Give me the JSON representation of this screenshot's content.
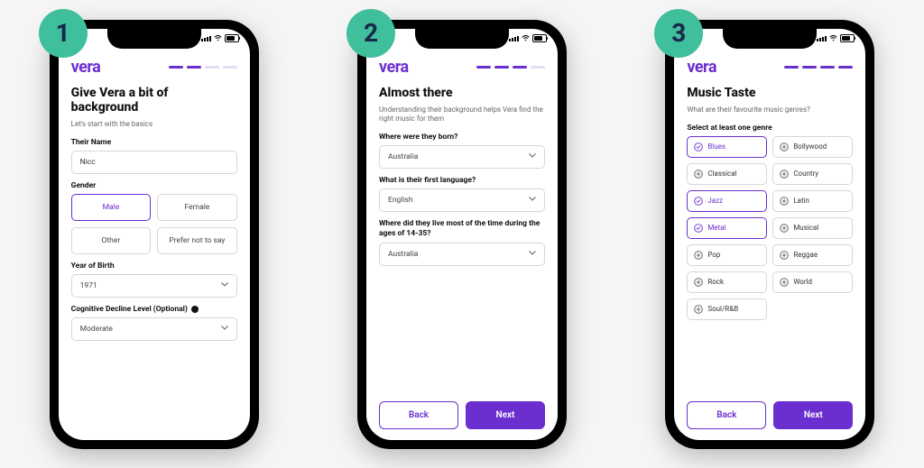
{
  "brand": "vera",
  "status_time": "",
  "screens": [
    {
      "step_number": "1",
      "progress": [
        true,
        true,
        false,
        false
      ],
      "title": "Give Vera a bit of background",
      "subtitle": "Let's start with the basics",
      "name_label": "Their Name",
      "name_value": "Nicc",
      "gender_label": "Gender",
      "gender_options": [
        {
          "label": "Male",
          "selected": true
        },
        {
          "label": "Female",
          "selected": false
        },
        {
          "label": "Other",
          "selected": false
        },
        {
          "label": "Prefer not to say",
          "selected": false
        }
      ],
      "yob_label": "Year of Birth",
      "yob_value": "1971",
      "decline_label": "Cognitive Decline Level (Optional)",
      "decline_value": "Moderate"
    },
    {
      "step_number": "2",
      "progress": [
        true,
        true,
        true,
        false
      ],
      "title": "Almost there",
      "subtitle": "Understanding their background helps Vera find the right music for them",
      "q1_label": "Where were they born?",
      "q1_value": "Australia",
      "q2_label": "What is their first language?",
      "q2_value": "English",
      "q3_label": "Where did they live most of the time during the ages of 14-35?",
      "q3_value": "Australia",
      "back_label": "Back",
      "next_label": "Next"
    },
    {
      "step_number": "3",
      "progress": [
        true,
        true,
        true,
        true
      ],
      "title": "Music Taste",
      "subtitle": "What are their favourite music genres?",
      "select_label": "Select at least one genre",
      "genres": [
        {
          "label": "Blues",
          "selected": true
        },
        {
          "label": "Bollywood",
          "selected": false
        },
        {
          "label": "Classical",
          "selected": false
        },
        {
          "label": "Country",
          "selected": false
        },
        {
          "label": "Jazz",
          "selected": true
        },
        {
          "label": "Latin",
          "selected": false
        },
        {
          "label": "Metal",
          "selected": true
        },
        {
          "label": "Musical",
          "selected": false
        },
        {
          "label": "Pop",
          "selected": false
        },
        {
          "label": "Reggae",
          "selected": false
        },
        {
          "label": "Rock",
          "selected": false
        },
        {
          "label": "World",
          "selected": false
        },
        {
          "label": "Soul/R&B",
          "selected": false
        }
      ],
      "back_label": "Back",
      "next_label": "Next"
    }
  ]
}
